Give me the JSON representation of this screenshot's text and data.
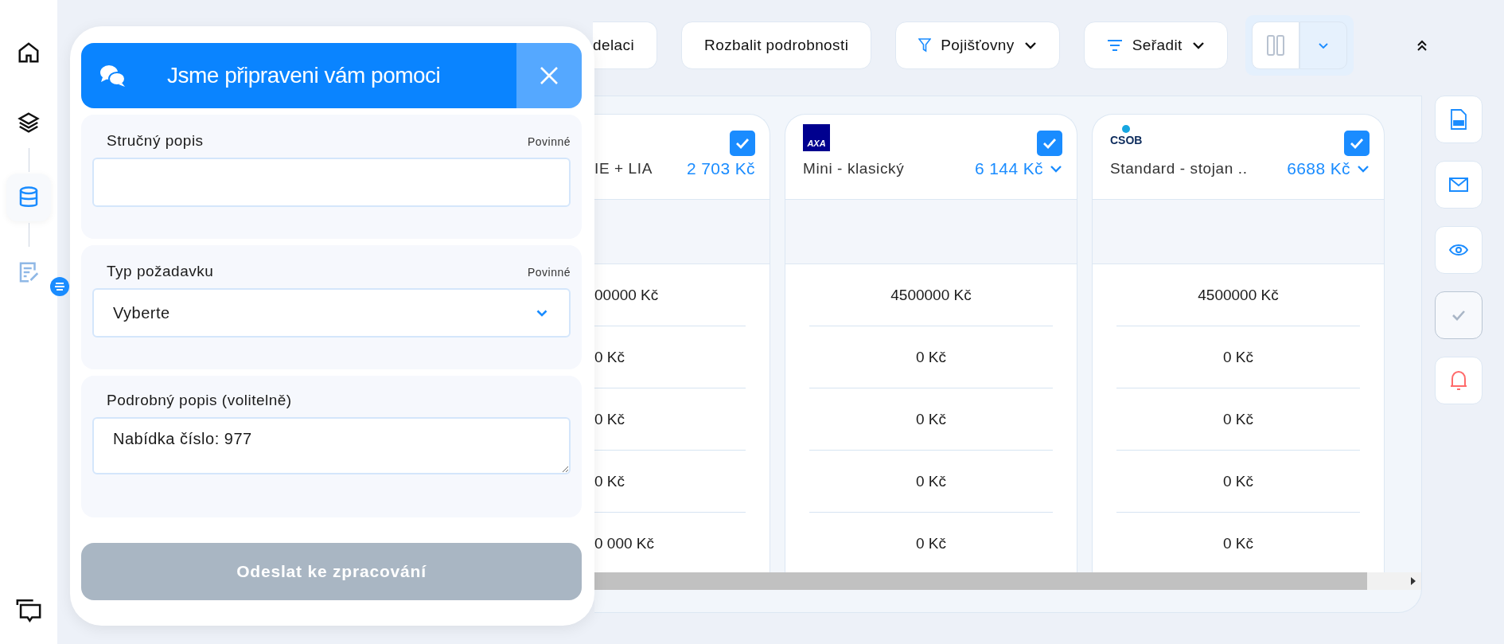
{
  "sidebar": {
    "items": [
      {
        "kind": "home",
        "selected": false
      },
      {
        "kind": "layers",
        "selected": false
      },
      {
        "kind": "database",
        "selected": true
      },
      {
        "kind": "notes",
        "selected": false
      }
    ],
    "bottom": {
      "kind": "chat"
    }
  },
  "help_panel": {
    "title": "Jsme připraveni vám pomoci",
    "fields": [
      {
        "kind": "text",
        "label": "Stručný popis",
        "note": "Povinné"
      },
      {
        "kind": "select",
        "label": "Typ požadavku",
        "note": "Povinné",
        "value": "Vyberte"
      },
      {
        "kind": "textarea",
        "label": "Podrobný popis (volitelně)",
        "value": "Nabídka číslo: 977"
      }
    ],
    "submit": {
      "label": "Odeslat ke zpracování",
      "disabled": true
    }
  },
  "toolbar": {
    "buttons": [
      {
        "kind": "plain",
        "label": "delaci"
      },
      {
        "kind": "plain",
        "label": "Rozbalit podrobnosti"
      },
      {
        "kind": "filter",
        "label": "Pojišťovny"
      },
      {
        "kind": "sort",
        "label": "Seřadit"
      }
    ]
  },
  "view_toggle": [
    {
      "kind": "columns",
      "selected": false
    },
    {
      "kind": "dropdown",
      "selected": true
    }
  ],
  "cards": [
    {
      "name": "IE + LIA",
      "price": "2 703 Kč",
      "checked": true,
      "dropdown": false,
      "rows": [
        "00000 Kč",
        "0 Kč",
        "0 Kč",
        "0 Kč",
        "0 000 Kč"
      ]
    },
    {
      "logo": {
        "kind": "axa",
        "text": "AXA"
      },
      "name": "Mini - klasický",
      "price": "6 144 Kč",
      "checked": true,
      "dropdown": true,
      "rows": [
        "4500000 Kč",
        "0 Kč",
        "0 Kč",
        "0 Kč",
        "0 Kč"
      ]
    },
    {
      "logo": {
        "kind": "csob",
        "text": "CSOB"
      },
      "name": "Standard - stojan ..",
      "price": "6688 Kč",
      "checked": true,
      "dropdown": true,
      "rows": [
        "4500000 Kč",
        "0 Kč",
        "0 Kč",
        "0 Kč",
        "0 Kč"
      ]
    }
  ],
  "actions": [
    {
      "kind": "pdf",
      "disabled": false
    },
    {
      "kind": "mail",
      "disabled": false
    },
    {
      "kind": "eye",
      "disabled": false
    },
    {
      "kind": "check",
      "disabled": true
    },
    {
      "kind": "bell",
      "disabled": false
    }
  ]
}
